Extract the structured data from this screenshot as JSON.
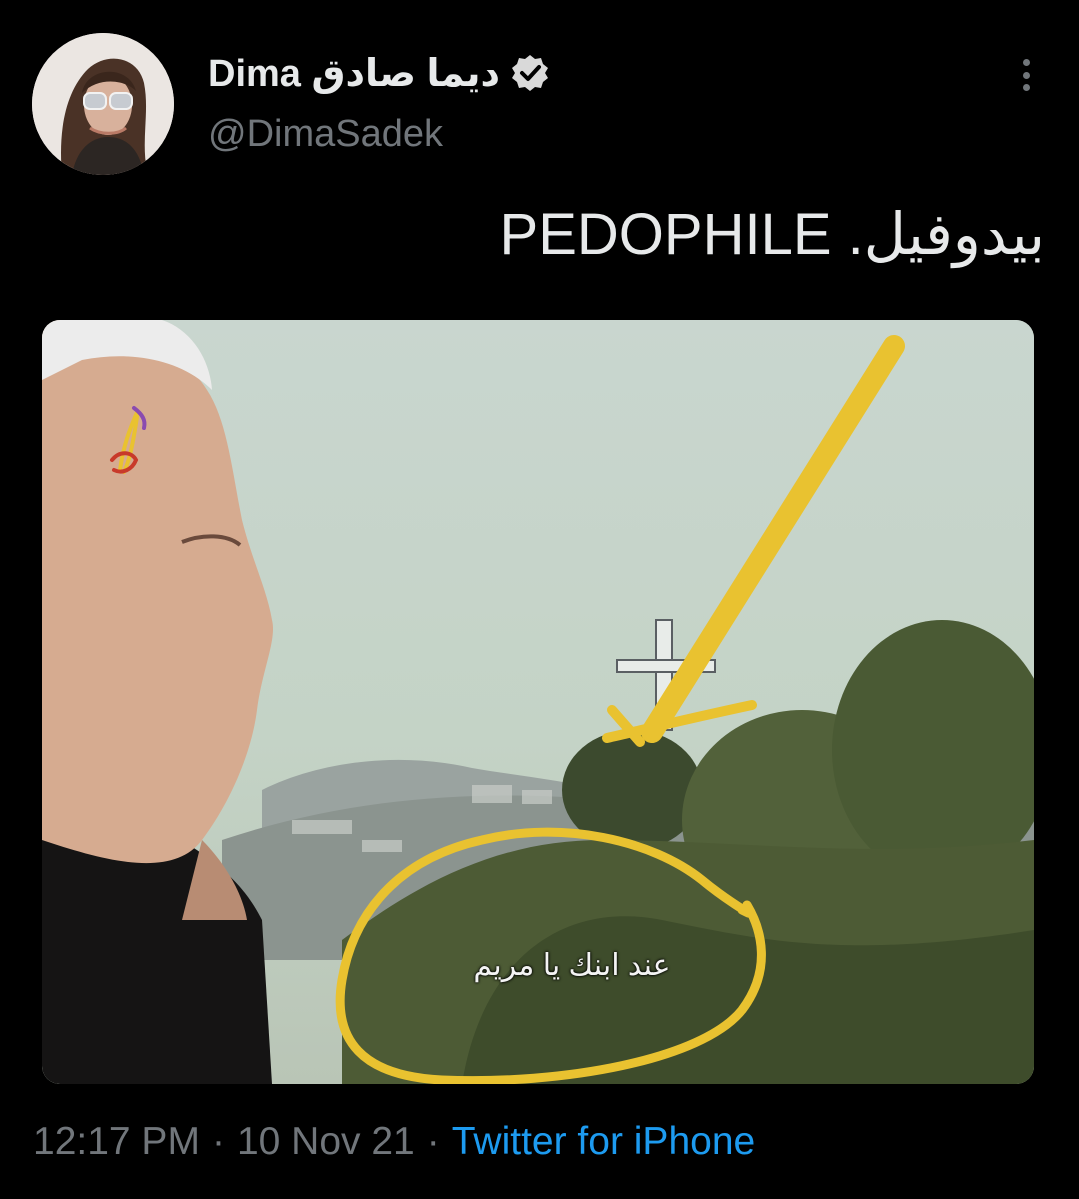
{
  "tweet": {
    "display_name": "Dima ديما صادق",
    "handle": "@DimaSadek",
    "verified_icon": "verified-badge-icon",
    "more_icon": "more-options-icon",
    "text": "بيدوفيل. PEDOPHILE",
    "media": {
      "caption": "عند ابنك يا مريم",
      "annotation_color": "#e9c230"
    },
    "time": "12:17 PM",
    "separator": "·",
    "date": "10 Nov 21",
    "source": "Twitter for iPhone"
  },
  "colors": {
    "background": "#000000",
    "primary_text": "#e7e9ea",
    "secondary_text": "#71767b",
    "link": "#1d9bf0",
    "verified_badge": "#d9d9d9"
  }
}
